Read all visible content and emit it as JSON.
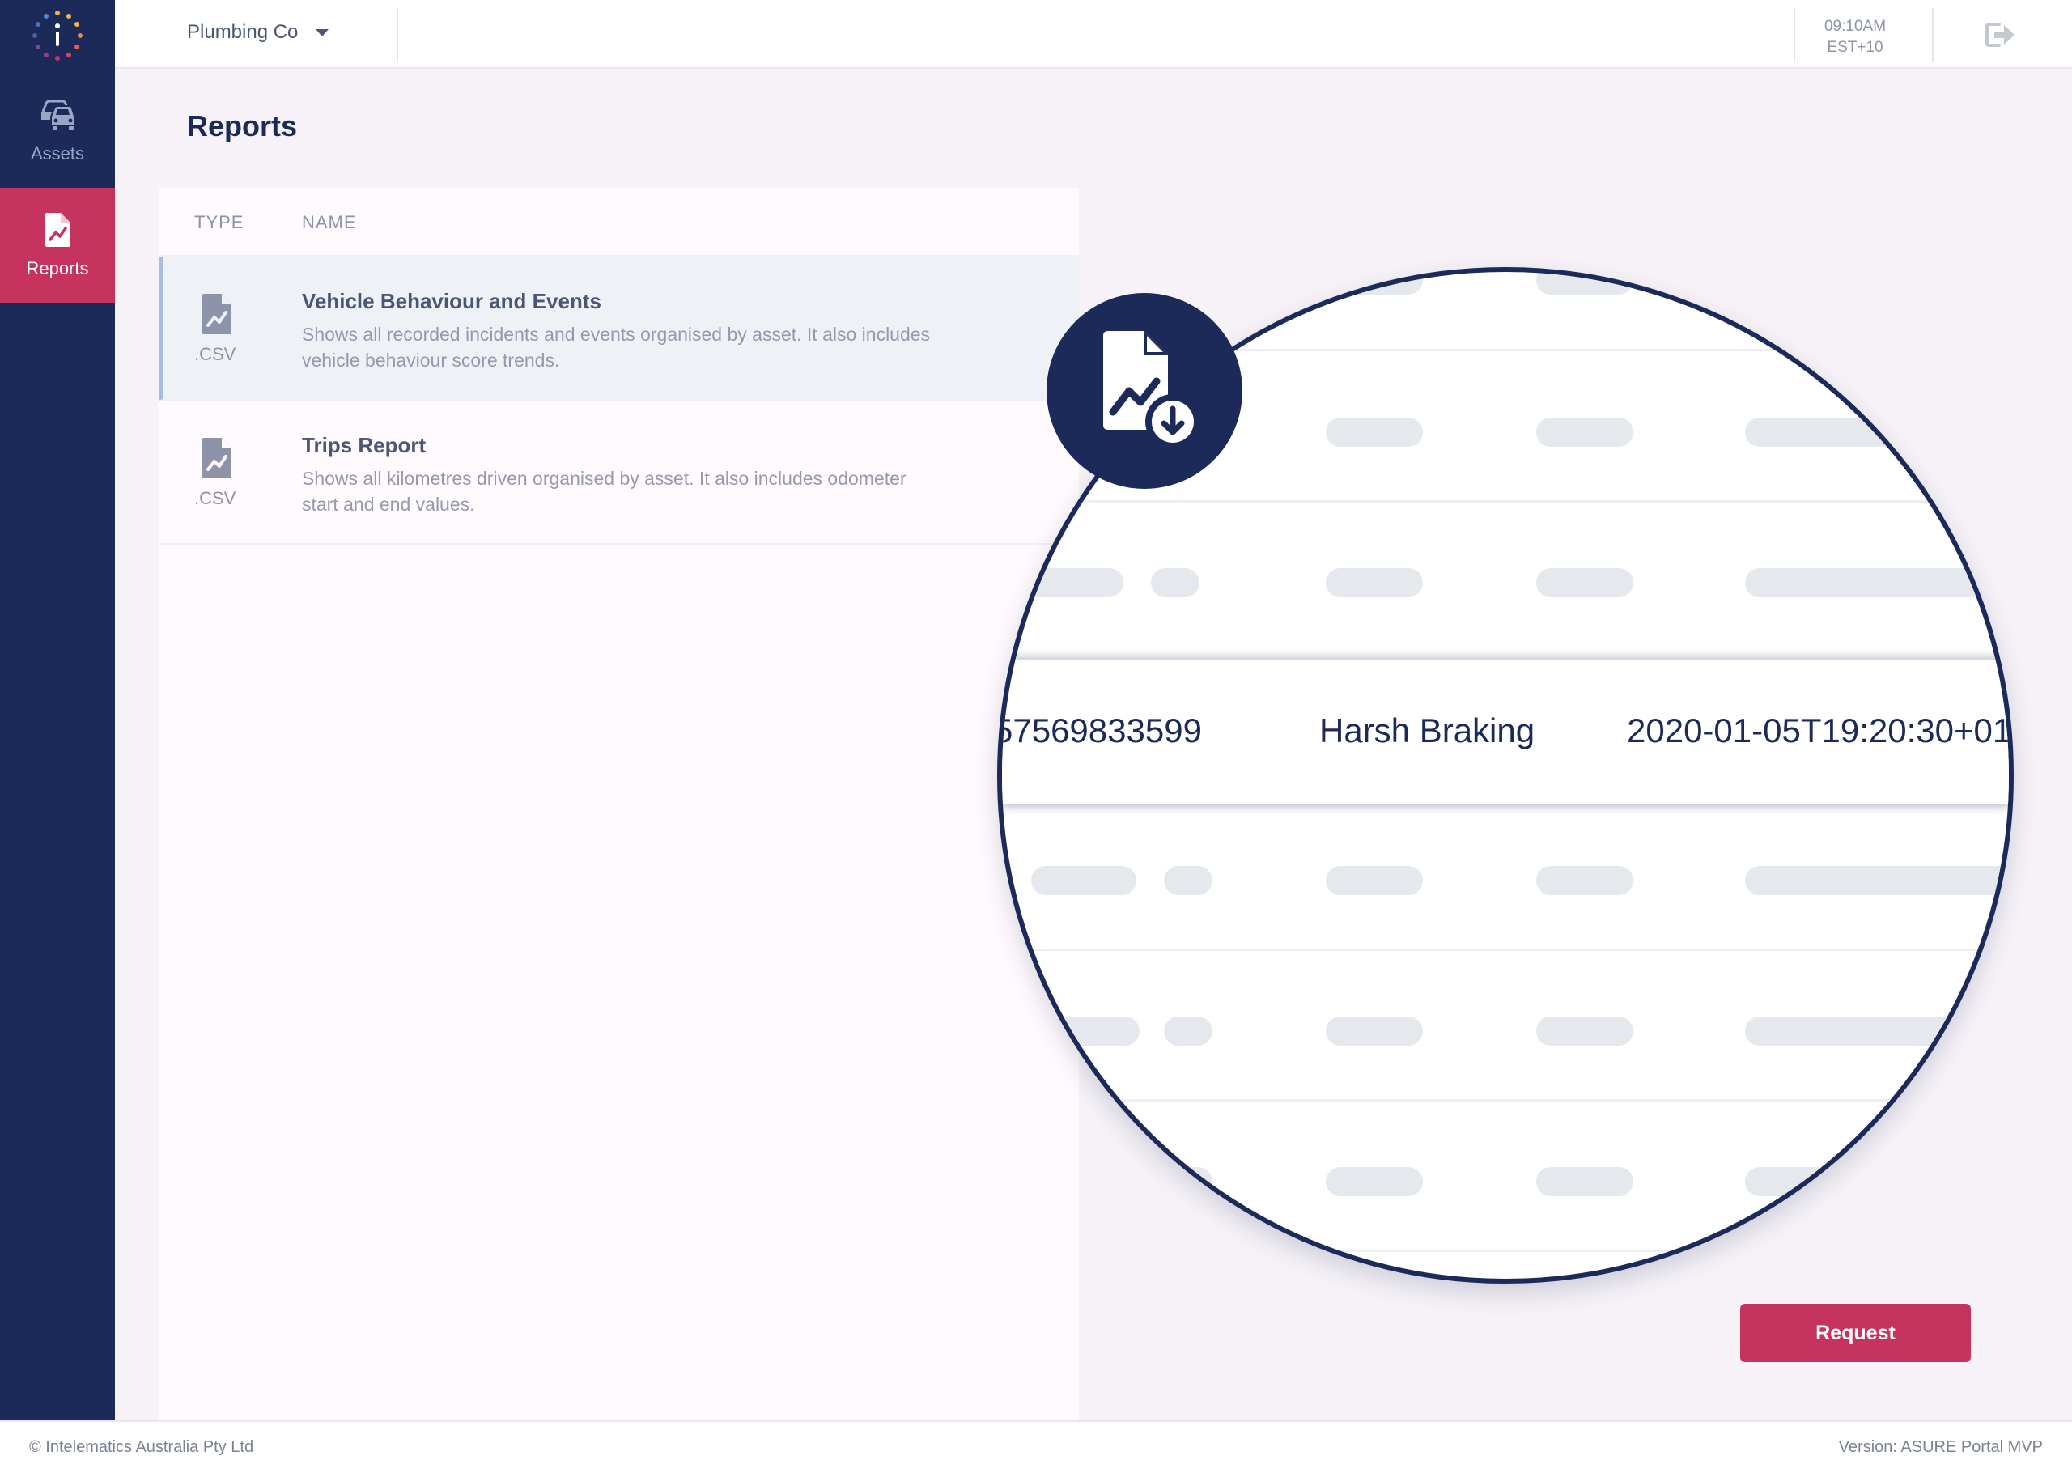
{
  "sidebar": {
    "logo_icon": "intelematics-logo-icon",
    "items": [
      {
        "label": "Assets",
        "icon": "cars-icon",
        "active": false
      },
      {
        "label": "Reports",
        "icon": "report-file-icon",
        "active": true
      }
    ]
  },
  "header": {
    "company": "Plumbing Co",
    "time": "09:10AM",
    "timezone": "EST+10",
    "logout_icon": "logout-icon"
  },
  "page": {
    "title": "Reports"
  },
  "table": {
    "columns": [
      "TYPE",
      "NAME"
    ],
    "rows": [
      {
        "type": ".CSV",
        "name": "Vehicle Behaviour and Events",
        "description": "Shows all recorded incidents and events organised by asset. It also includes vehicle behaviour score trends.",
        "selected": true
      },
      {
        "type": ".CSV",
        "name": "Trips Report",
        "description": "Shows all kilometres driven organised by asset. It also includes odometer start and end values.",
        "selected": false
      }
    ]
  },
  "magnifier": {
    "highlight_row": [
      "57569833599",
      "Harsh Braking",
      "2020-01-05T19:20:30+01"
    ],
    "badge_icon": "report-download-icon"
  },
  "actions": {
    "request_label": "Request"
  },
  "colors": {
    "navy": "#1c2a5a",
    "accent": "#c7335f",
    "selected_bar": "#a6bde3"
  },
  "footer": {
    "copyright": "© Intelematics Australia Pty Ltd",
    "version": "Version: ASURE Portal MVP"
  }
}
